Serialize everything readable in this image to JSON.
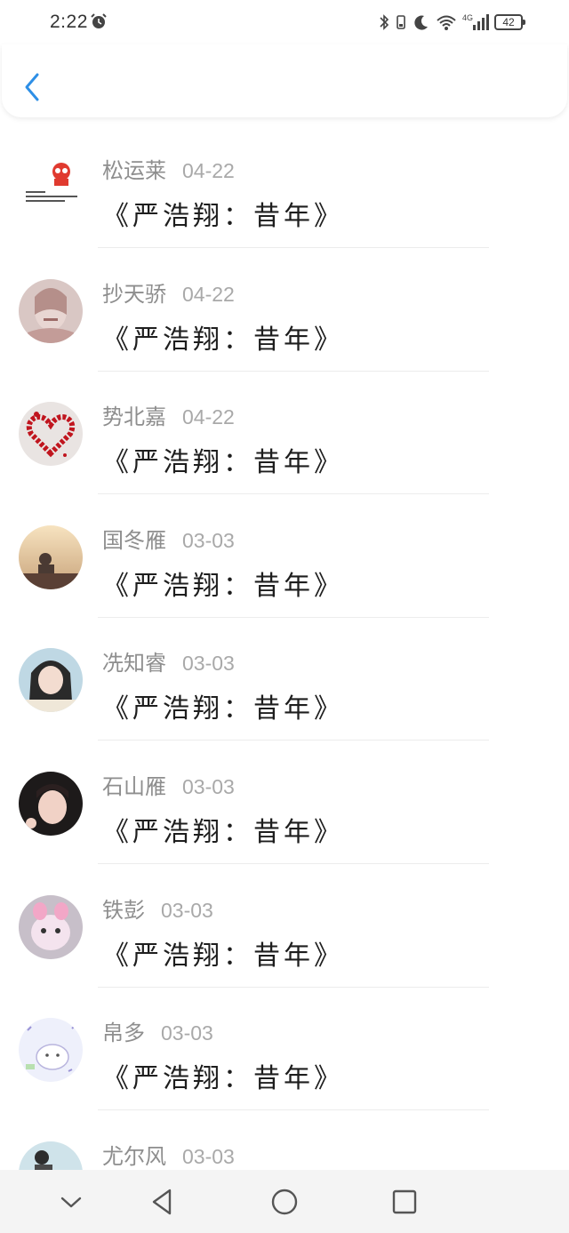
{
  "status_bar": {
    "time": "2:22",
    "battery": "42",
    "network": "4G",
    "icons": [
      "alarm-icon",
      "bluetooth-icon",
      "vibrate-icon",
      "moon-icon",
      "wifi-icon",
      "signal-icon",
      "battery-icon"
    ]
  },
  "header": {
    "back_icon": "chevron-left-icon"
  },
  "list": [
    {
      "name": "松运莱",
      "date": "04-22",
      "message": "《严浩翔：昔年》",
      "avatar": "cartoon-avatar"
    },
    {
      "name": "抄天骄",
      "date": "04-22",
      "message": "《严浩翔：昔年》",
      "avatar": "anime-avatar"
    },
    {
      "name": "势北嘉",
      "date": "04-22",
      "message": "《严浩翔：昔年》",
      "avatar": "heart-avatar"
    },
    {
      "name": "国冬雁",
      "date": "03-03",
      "message": "《严浩翔：昔年》",
      "avatar": "sunset-avatar"
    },
    {
      "name": "冼知睿",
      "date": "03-03",
      "message": "《严浩翔：昔年》",
      "avatar": "girl-avatar"
    },
    {
      "name": "石山雁",
      "date": "03-03",
      "message": "《严浩翔：昔年》",
      "avatar": "selfie-avatar"
    },
    {
      "name": "铁彭",
      "date": "03-03",
      "message": "《严浩翔：昔年》",
      "avatar": "plush-avatar"
    },
    {
      "name": "帛多",
      "date": "03-03",
      "message": "《严浩翔：昔年》",
      "avatar": "doodle-avatar"
    },
    {
      "name": "尤尔风",
      "date": "03-03",
      "message": "",
      "avatar": "photo-avatar"
    }
  ],
  "navbar": {
    "buttons": [
      "collapse-icon",
      "back-triangle-icon",
      "home-circle-icon",
      "recents-square-icon"
    ]
  }
}
